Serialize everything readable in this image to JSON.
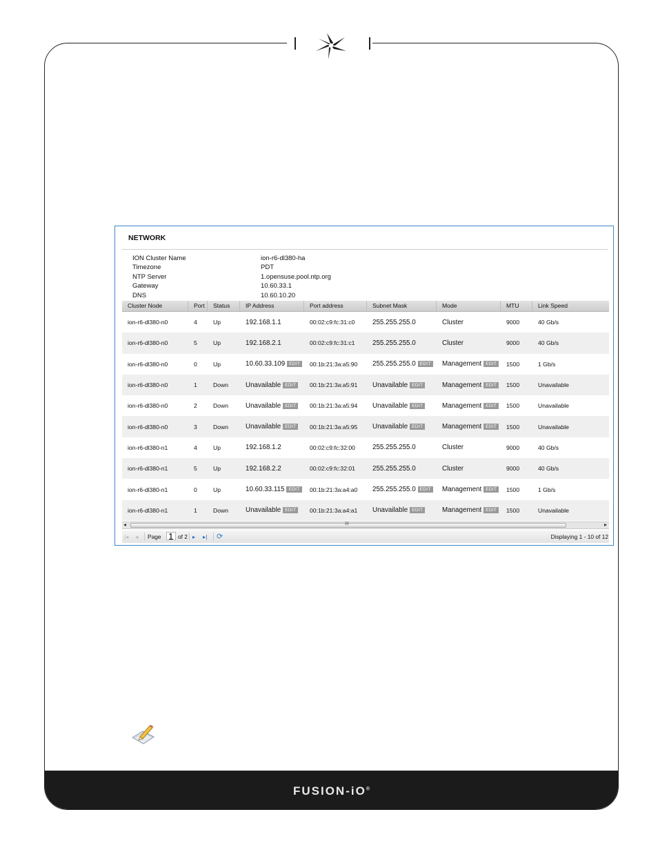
{
  "footer": {
    "brand": "FUSION-iO",
    "trademark": "®"
  },
  "panel": {
    "title": "NETWORK",
    "info": [
      {
        "label": "ION Cluster Name",
        "value": "ion-r6-dl380-ha"
      },
      {
        "label": "Timezone",
        "value": "PDT"
      },
      {
        "label": "NTP Server",
        "value": "1.opensuse.pool.ntp.org"
      },
      {
        "label": "Gateway",
        "value": "10.60.33.1"
      },
      {
        "label": "DNS",
        "value": "10.60.10.20"
      }
    ],
    "columns": [
      "Cluster Node",
      "Port",
      "Status",
      "IP Address",
      "Port address",
      "Subnet Mask",
      "Mode",
      "MTU",
      "Link Speed"
    ],
    "edit_label": "EDIT",
    "rows": [
      {
        "node": "ion-r6-dl380-n0",
        "port": "4",
        "status": "Up",
        "ip": "192.168.1.1",
        "mac": "00:02:c9:fc:31:c0",
        "mask": "255.255.255.0",
        "mode": "Cluster",
        "mtu": "9000",
        "speed": "40 Gb/s",
        "editable": false
      },
      {
        "node": "ion-r6-dl380-n0",
        "port": "5",
        "status": "Up",
        "ip": "192.168.2.1",
        "mac": "00:02:c9:fc:31:c1",
        "mask": "255.255.255.0",
        "mode": "Cluster",
        "mtu": "9000",
        "speed": "40 Gb/s",
        "editable": false
      },
      {
        "node": "ion-r6-dl380-n0",
        "port": "0",
        "status": "Up",
        "ip": "10.60.33.109",
        "mac": "00:1b:21:3a:a5:90",
        "mask": "255.255.255.0",
        "mode": "Management",
        "mtu": "1500",
        "speed": "1 Gb/s",
        "editable": true
      },
      {
        "node": "ion-r6-dl380-n0",
        "port": "1",
        "status": "Down",
        "ip": "Unavailable",
        "mac": "00:1b:21:3a:a5:91",
        "mask": "Unavailable",
        "mode": "Management",
        "mtu": "1500",
        "speed": "Unavailable",
        "editable": true
      },
      {
        "node": "ion-r6-dl380-n0",
        "port": "2",
        "status": "Down",
        "ip": "Unavailable",
        "mac": "00:1b:21:3a:a5:94",
        "mask": "Unavailable",
        "mode": "Management",
        "mtu": "1500",
        "speed": "Unavailable",
        "editable": true
      },
      {
        "node": "ion-r6-dl380-n0",
        "port": "3",
        "status": "Down",
        "ip": "Unavailable",
        "mac": "00:1b:21:3a:a5:95",
        "mask": "Unavailable",
        "mode": "Management",
        "mtu": "1500",
        "speed": "Unavailable",
        "editable": true
      },
      {
        "node": "ion-r6-dl380-n1",
        "port": "4",
        "status": "Up",
        "ip": "192.168.1.2",
        "mac": "00:02:c9:fc:32:00",
        "mask": "255.255.255.0",
        "mode": "Cluster",
        "mtu": "9000",
        "speed": "40 Gb/s",
        "editable": false
      },
      {
        "node": "ion-r6-dl380-n1",
        "port": "5",
        "status": "Up",
        "ip": "192.168.2.2",
        "mac": "00:02:c9:fc:32:01",
        "mask": "255.255.255.0",
        "mode": "Cluster",
        "mtu": "9000",
        "speed": "40 Gb/s",
        "editable": false
      },
      {
        "node": "ion-r6-dl380-n1",
        "port": "0",
        "status": "Up",
        "ip": "10.60.33.115",
        "mac": "00:1b:21:3a:a4:a0",
        "mask": "255.255.255.0",
        "mode": "Management",
        "mtu": "1500",
        "speed": "1 Gb/s",
        "editable": true
      },
      {
        "node": "ion-r6-dl380-n1",
        "port": "1",
        "status": "Down",
        "ip": "Unavailable",
        "mac": "00:1b:21:3a:a4:a1",
        "mask": "Unavailable",
        "mode": "Management",
        "mtu": "1500",
        "speed": "Unavailable",
        "editable": true
      }
    ],
    "pager": {
      "page_label": "Page",
      "page_value": "1",
      "of_label": "of 2",
      "display_text": "Displaying 1 - 10 of 12",
      "scroll_grip": "III"
    }
  },
  "icons": {
    "logo": "fusion-io-star-logo",
    "note": "note-pencil-icon"
  }
}
